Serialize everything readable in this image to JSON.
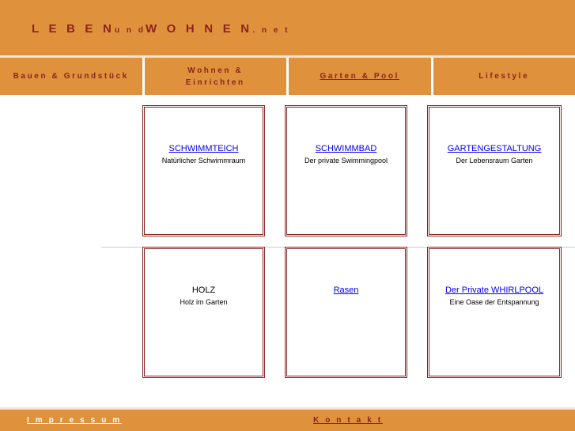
{
  "colors": {
    "banner": "#e0913c",
    "banner_text": "#8b2420",
    "link": "#0000ee",
    "card_border": "#8b2420",
    "divider": "#cccccc",
    "footer_impressum_text": "#ffffff"
  },
  "header": {
    "brand_part1": "L E B E N",
    "brand_part2": "u n d",
    "brand_part3": "W O H N E N",
    "brand_part4": ". n e t"
  },
  "nav": {
    "items": [
      {
        "label": "Bauen & Grundstück",
        "active": false
      },
      {
        "label_line1": "Wohnen &",
        "label_line2": "Einrichten",
        "active": false
      },
      {
        "label": "Garten & Pool",
        "active": true
      },
      {
        "label": "Lifestyle",
        "active": false
      }
    ]
  },
  "main": {
    "rows": [
      {
        "cards": [
          {
            "title": "SCHWIMMTEICH",
            "subtitle": "Natürlicher Schwimmraum",
            "is_link": true
          },
          {
            "title": "SCHWIMMBAD",
            "subtitle": "Der private Swimmingpool",
            "is_link": true
          },
          {
            "title": "GARTENGESTALTUNG",
            "subtitle": "Der Lebensraum Garten",
            "is_link": true
          }
        ]
      },
      {
        "cards": [
          {
            "title": "HOLZ",
            "subtitle": "Holz im Garten",
            "is_link": false
          },
          {
            "title": "Rasen",
            "subtitle": "",
            "is_link": true
          },
          {
            "title": "Der Private WHIRLPOOL",
            "subtitle": "Eine Oase der Entspannung",
            "is_link": true
          }
        ]
      }
    ]
  },
  "footer": {
    "impressum": "I m p r e s s u m",
    "kontakt": "K o n t a k t"
  }
}
